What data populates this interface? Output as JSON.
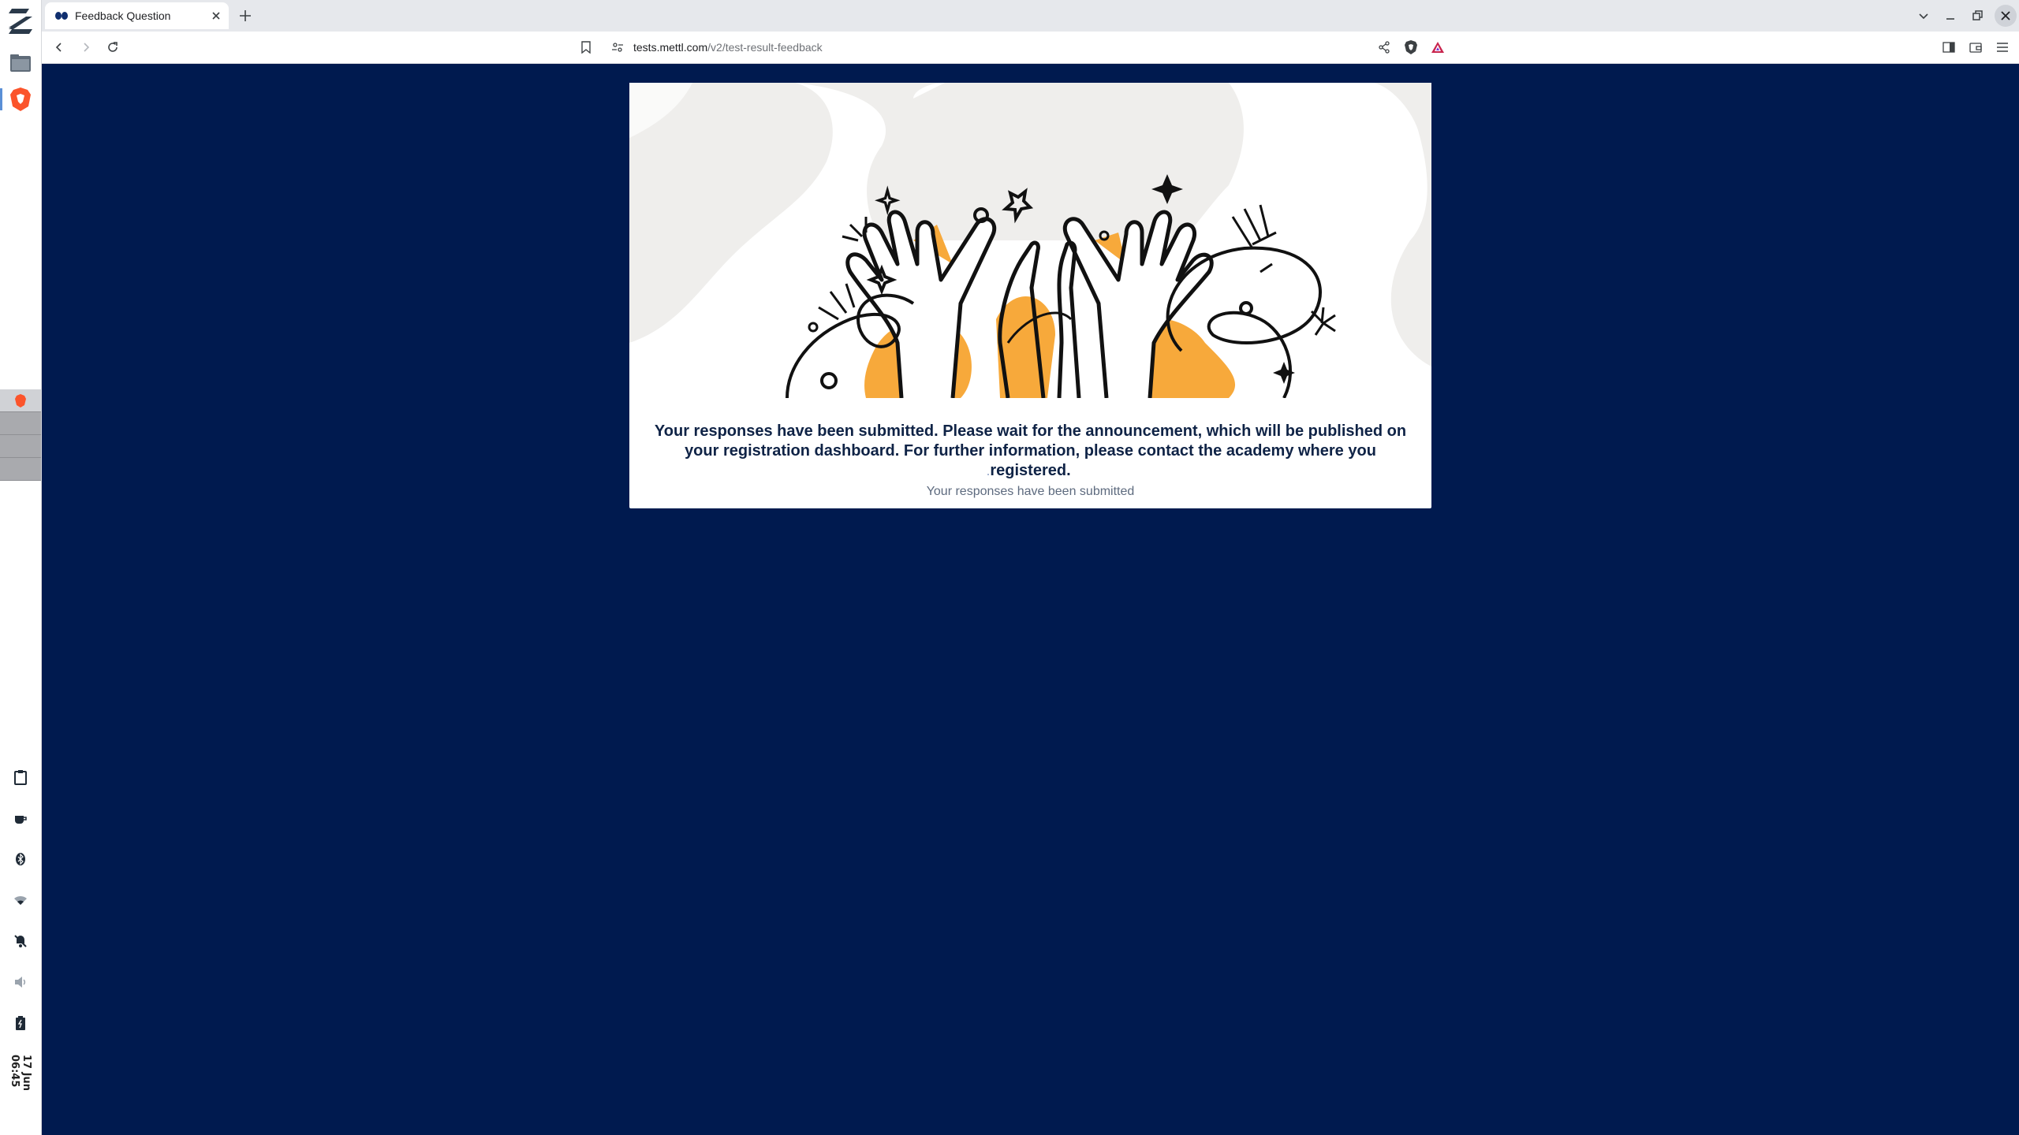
{
  "browser": {
    "tab_title": "Feedback Question",
    "url_host": "tests.mettl.com",
    "url_path": "/v2/test-result-feedback"
  },
  "page": {
    "message": "Your responses have been submitted. Please wait for the announcement, which will be published on your registration dashboard. For further information, please contact the academy where you registered.",
    "sub_message": "Your responses have been submitted"
  },
  "os_panel": {
    "clock": "17 Jun 06:45"
  },
  "colors": {
    "page_bg": "#001a4f",
    "accent_orange": "#f7a93b",
    "illustration_bg": "#efeeec"
  }
}
